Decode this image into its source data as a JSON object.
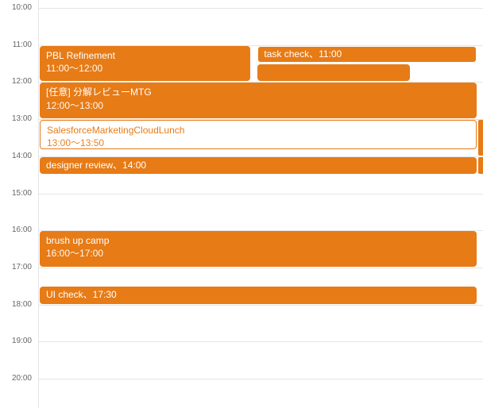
{
  "calendar": {
    "startHour": 10,
    "endHour": 20,
    "pxPerHour": 46.7,
    "gridTopOffset": 0,
    "hourLabels": [
      "10:00",
      "11:00",
      "12:00",
      "13:00",
      "14:00",
      "15:00",
      "16:00",
      "17:00",
      "18:00",
      "19:00",
      "20:00"
    ]
  },
  "events": [
    {
      "id": "pbl-refinement",
      "title": "PBL Refinement",
      "timeLabel": "11:00〜12:00",
      "startHour": 11.0,
      "endHour": 12.0,
      "style": "orange",
      "leftPct": 0,
      "widthPct": 48,
      "showTime": true
    },
    {
      "id": "task-check",
      "title": "task check、11:00",
      "timeLabel": "",
      "startHour": 11.0,
      "endHour": 11.5,
      "style": "orange",
      "leftPct": 49,
      "widthPct": 50,
      "showTime": false,
      "small": true,
      "innerBorder": true
    },
    {
      "id": "orange-block-1130",
      "title": "",
      "timeLabel": "",
      "startHour": 11.5,
      "endHour": 12.0,
      "style": "orange",
      "leftPct": 49,
      "widthPct": 35,
      "showTime": false,
      "noText": true
    },
    {
      "id": "review-mtg",
      "title": "[任意] 分解レビューMTG",
      "timeLabel": "12:00〜13:00",
      "startHour": 12.0,
      "endHour": 13.0,
      "style": "orange",
      "leftPct": 0,
      "widthPct": 99,
      "showTime": true
    },
    {
      "id": "sfmc-lunch",
      "title": "SalesforceMarketingCloudLunch",
      "timeLabel": "13:00〜13:50",
      "startHour": 13.0,
      "endHour": 13.83,
      "style": "white",
      "leftPct": 0,
      "widthPct": 99,
      "showTime": true
    },
    {
      "id": "designer-review",
      "title": "designer review、14:00",
      "timeLabel": "",
      "startHour": 14.0,
      "endHour": 14.5,
      "style": "orange",
      "leftPct": 0,
      "widthPct": 99,
      "showTime": false,
      "small": true
    },
    {
      "id": "brush-up-camp",
      "title": "brush up camp",
      "timeLabel": "16:00〜17:00",
      "startHour": 16.0,
      "endHour": 17.0,
      "style": "orange",
      "leftPct": 0,
      "widthPct": 99,
      "showTime": true
    },
    {
      "id": "ui-check",
      "title": "UI check、17:30",
      "timeLabel": "",
      "startHour": 17.5,
      "endHour": 18.0,
      "style": "orange",
      "leftPct": 0,
      "widthPct": 99,
      "showTime": false,
      "small": true
    }
  ],
  "sideEvents": [
    {
      "id": "side-13",
      "startHour": 13.0,
      "endHour": 14.0
    },
    {
      "id": "side-14",
      "startHour": 14.0,
      "endHour": 14.5
    }
  ]
}
